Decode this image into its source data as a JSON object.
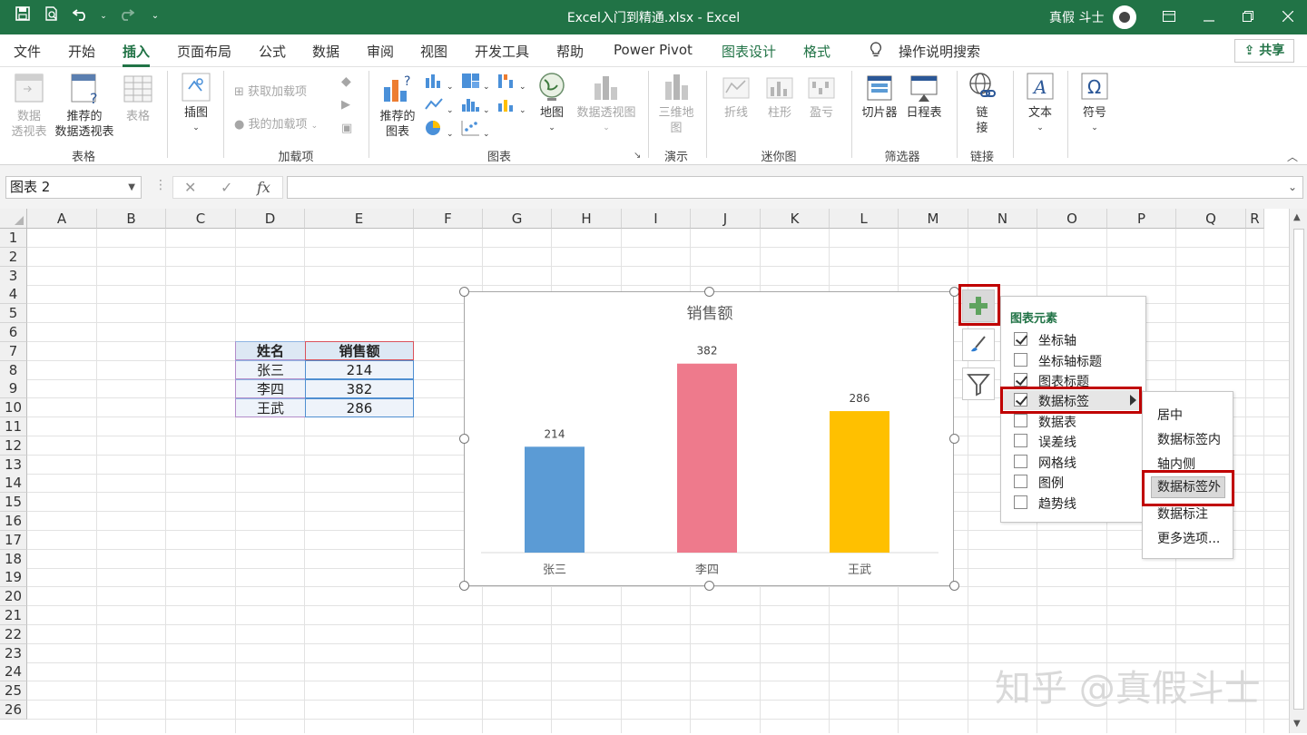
{
  "titlebar": {
    "title": "Excel入门到精通.xlsx  -  Excel",
    "user": "真假 斗士",
    "qat_icons": [
      "save-icon",
      "print-preview-icon",
      "undo-icon",
      "redo-icon",
      "customize-icon"
    ]
  },
  "tabs": [
    {
      "label": "文件"
    },
    {
      "label": "开始"
    },
    {
      "label": "插入"
    },
    {
      "label": "页面布局"
    },
    {
      "label": "公式"
    },
    {
      "label": "数据"
    },
    {
      "label": "审阅"
    },
    {
      "label": "视图"
    },
    {
      "label": "开发工具"
    },
    {
      "label": "帮助"
    },
    {
      "label": "Power Pivot"
    },
    {
      "label": "图表设计"
    },
    {
      "label": "格式"
    },
    {
      "label": "操作说明搜索"
    }
  ],
  "share": "共享",
  "ribbon": {
    "pivot": "数据\n透视表",
    "rec_pivot": "推荐的\n数据透视表",
    "table": "表格",
    "group_tables": "表格",
    "illustrations": "插图",
    "get_addins": "获取加载项",
    "my_addins": "我的加载项",
    "group_addins": "加载项",
    "rec_charts": "推荐的\n图表",
    "group_charts": "图表",
    "map": "地图",
    "pivot_chart": "数据透视图",
    "map3d": "三维地\n图",
    "group_tours": "演示",
    "line": "折线",
    "column": "柱形",
    "winloss": "盈亏",
    "group_spark": "迷你图",
    "slicer": "切片器",
    "timeline": "日程表",
    "group_filters": "筛选器",
    "link": "链\n接",
    "group_links": "链接",
    "text": "文本",
    "symbol": "符号"
  },
  "formula": {
    "namebox": "图表 2",
    "fx": "fx"
  },
  "columns": [
    "A",
    "B",
    "C",
    "D",
    "E",
    "F",
    "G",
    "H",
    "I",
    "J",
    "K",
    "L",
    "M",
    "N",
    "O",
    "P",
    "Q",
    "R"
  ],
  "rows": [
    "1",
    "2",
    "3",
    "4",
    "5",
    "6",
    "7",
    "8",
    "9",
    "10",
    "11",
    "12",
    "13",
    "14",
    "15",
    "16",
    "17",
    "18",
    "19",
    "20",
    "21",
    "22",
    "23",
    "24",
    "25",
    "26"
  ],
  "table": {
    "header": [
      "姓名",
      "销售额"
    ],
    "rows": [
      [
        "张三",
        "214"
      ],
      [
        "李四",
        "382"
      ],
      [
        "王武",
        "286"
      ]
    ]
  },
  "chart_data": {
    "type": "bar",
    "title": "销售额",
    "categories": [
      "张三",
      "李四",
      "王武"
    ],
    "values": [
      214,
      382,
      286
    ],
    "colors": [
      "#5b9bd5",
      "#ee7a8c",
      "#ffc000"
    ],
    "ylim": [
      0,
      420
    ],
    "grid": false,
    "data_labels": true
  },
  "chart_elements": {
    "title": "图表元素",
    "items": [
      {
        "label": "坐标轴",
        "checked": true
      },
      {
        "label": "坐标轴标题",
        "checked": false
      },
      {
        "label": "图表标题",
        "checked": true
      },
      {
        "label": "数据标签",
        "checked": true
      },
      {
        "label": "数据表",
        "checked": false
      },
      {
        "label": "误差线",
        "checked": false
      },
      {
        "label": "网格线",
        "checked": false
      },
      {
        "label": "图例",
        "checked": false
      },
      {
        "label": "趋势线",
        "checked": false
      }
    ]
  },
  "label_options": [
    "居中",
    "数据标签内",
    "轴内侧",
    "数据标签外",
    "数据标注",
    "更多选项..."
  ],
  "watermark": "知乎 @真假斗士",
  "colors": {
    "accent": "#217346",
    "highlight": "#c00000"
  }
}
